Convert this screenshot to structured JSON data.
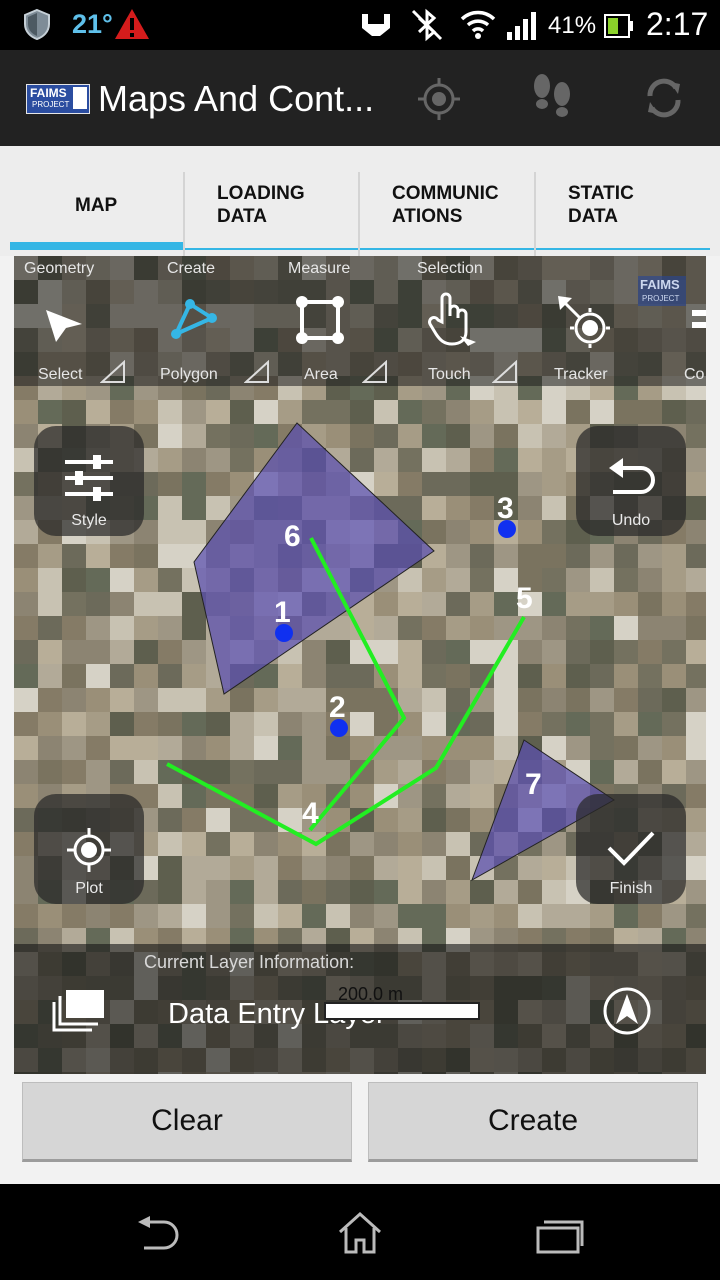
{
  "status_bar": {
    "temperature": "21°",
    "battery": "41%",
    "time": "2:17"
  },
  "action_bar": {
    "logo_text": "FAIMS",
    "logo_subtext": "PROJECT",
    "title": "Maps And Cont...",
    "icons": [
      "gps-target-icon",
      "footsteps-icon",
      "sync-icon"
    ]
  },
  "tabs": [
    {
      "line1": "MAP",
      "line2": "",
      "selected": true
    },
    {
      "line1": "LOADING",
      "line2": "DATA",
      "selected": false
    },
    {
      "line1": "COMMUNIC",
      "line2": "ATIONS",
      "selected": false
    },
    {
      "line1": "STATIC",
      "line2": "DATA",
      "selected": false
    }
  ],
  "accent_color": "#35b6e5",
  "map": {
    "toolbar": {
      "groups": [
        "Geometry",
        "Create",
        "Measure",
        "Selection"
      ],
      "tools": [
        "Select",
        "Polygon",
        "Area",
        "Touch",
        "Tracker",
        "Co"
      ],
      "watermark": "FAIMS",
      "watermark_sub": "PROJECT"
    },
    "controls": {
      "style": "Style",
      "undo": "Undo",
      "plot": "Plot",
      "finish": "Finish"
    },
    "markers": [
      "1",
      "2",
      "3",
      "4",
      "5",
      "6",
      "7"
    ],
    "info": {
      "heading": "Current Layer Information:",
      "layer_name": "Data Entry Layer",
      "scale": "200.0 m"
    },
    "colors": {
      "polygon": "#5a4fb0",
      "line": "#22ee22",
      "point": "#1030f0"
    }
  },
  "buttons": {
    "clear": "Clear",
    "create": "Create"
  }
}
